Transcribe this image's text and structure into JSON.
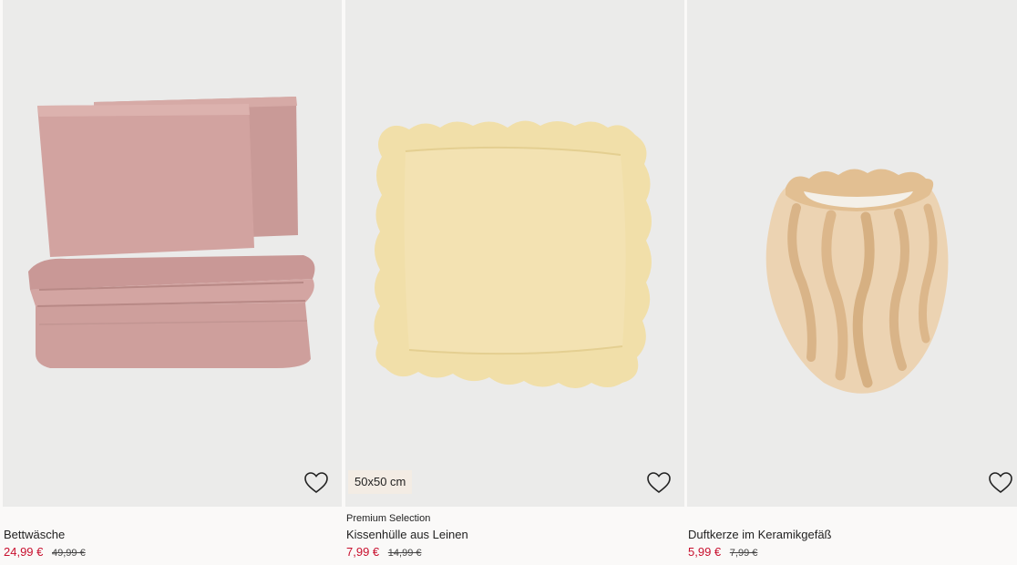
{
  "products": [
    {
      "marker": "",
      "title": "Bettwäsche",
      "sale_price": "24,99 €",
      "original_price": "49,99 €",
      "badge": "",
      "heart_icon": "heart-outline-icon"
    },
    {
      "marker": "Premium Selection",
      "title": "Kissenhülle aus Leinen",
      "sale_price": "7,99 €",
      "original_price": "14,99 €",
      "badge": "50x50 cm",
      "heart_icon": "heart-outline-icon"
    },
    {
      "marker": "",
      "title": "Duftkerze im Keramikgefäß",
      "sale_price": "5,99 €",
      "original_price": "7,99 €",
      "badge": "",
      "heart_icon": "heart-outline-icon"
    }
  ],
  "colors": {
    "sale": "#c8102e",
    "image_background": "#ebebea",
    "badge_background": "#f3ece4"
  }
}
